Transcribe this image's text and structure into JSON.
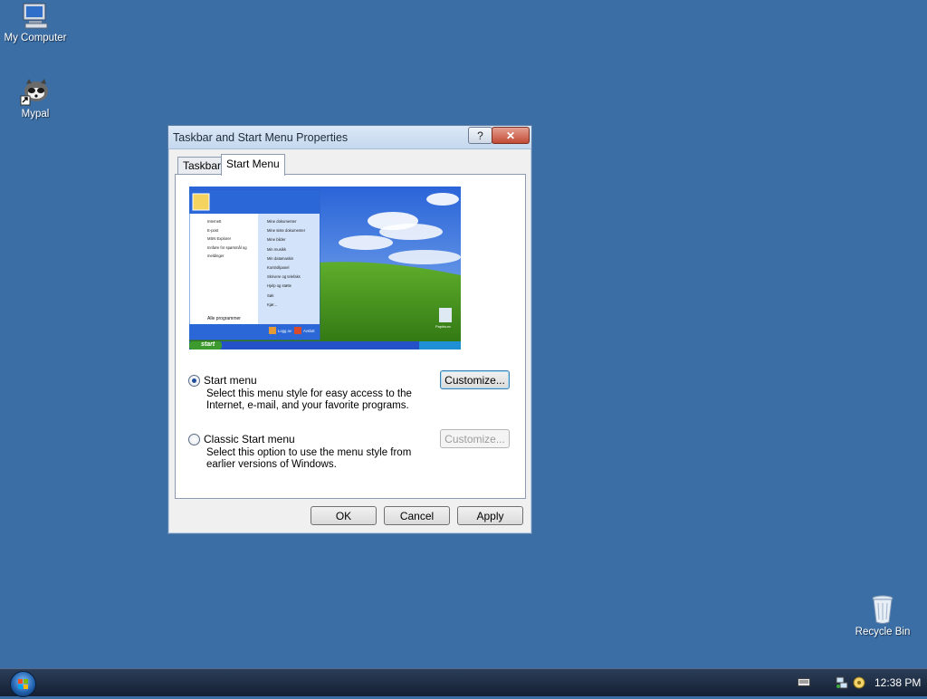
{
  "desktop": {
    "icons": [
      {
        "label": "My Computer"
      },
      {
        "label": "Mypal"
      },
      {
        "label": "Recycle Bin"
      }
    ]
  },
  "dialog": {
    "title": "Taskbar and Start Menu Properties",
    "help_glyph": "?",
    "close_glyph": "✕",
    "tabs": [
      {
        "label": "Taskbar"
      },
      {
        "label": "Start Menu"
      }
    ],
    "preview": {
      "start_label": "start",
      "all_programs": "Alle programmer",
      "left_items": [
        "Internett",
        "E-post",
        "MSN Explorer",
        "Innføre for spørsmål og meldinger"
      ],
      "right_items": [
        "Mine dokumenter",
        "Mine siste dokumenter",
        "Mine bilder",
        "Min musikk",
        "Min datamaskin",
        "Kontrollpanel",
        "Skrivere og telefaks",
        "Hjelp og støtte",
        "Søk",
        "Kjør..."
      ],
      "logoff": "Logg av",
      "shutdown": "Avslutt",
      "bin_label": "Papirkurv"
    },
    "options": {
      "start_menu_label": "Start menu",
      "start_menu_desc": "Select this menu style for easy access to the Internet, e-mail, and your favorite programs.",
      "classic_label": "Classic Start menu",
      "classic_desc": "Select this option to use the menu style from earlier versions of Windows.",
      "customize_label": "Customize...",
      "customize_disabled_label": "Customize..."
    },
    "buttons": {
      "ok": "OK",
      "cancel": "Cancel",
      "apply": "Apply"
    }
  },
  "taskbar": {
    "clock": "12:38 PM"
  }
}
